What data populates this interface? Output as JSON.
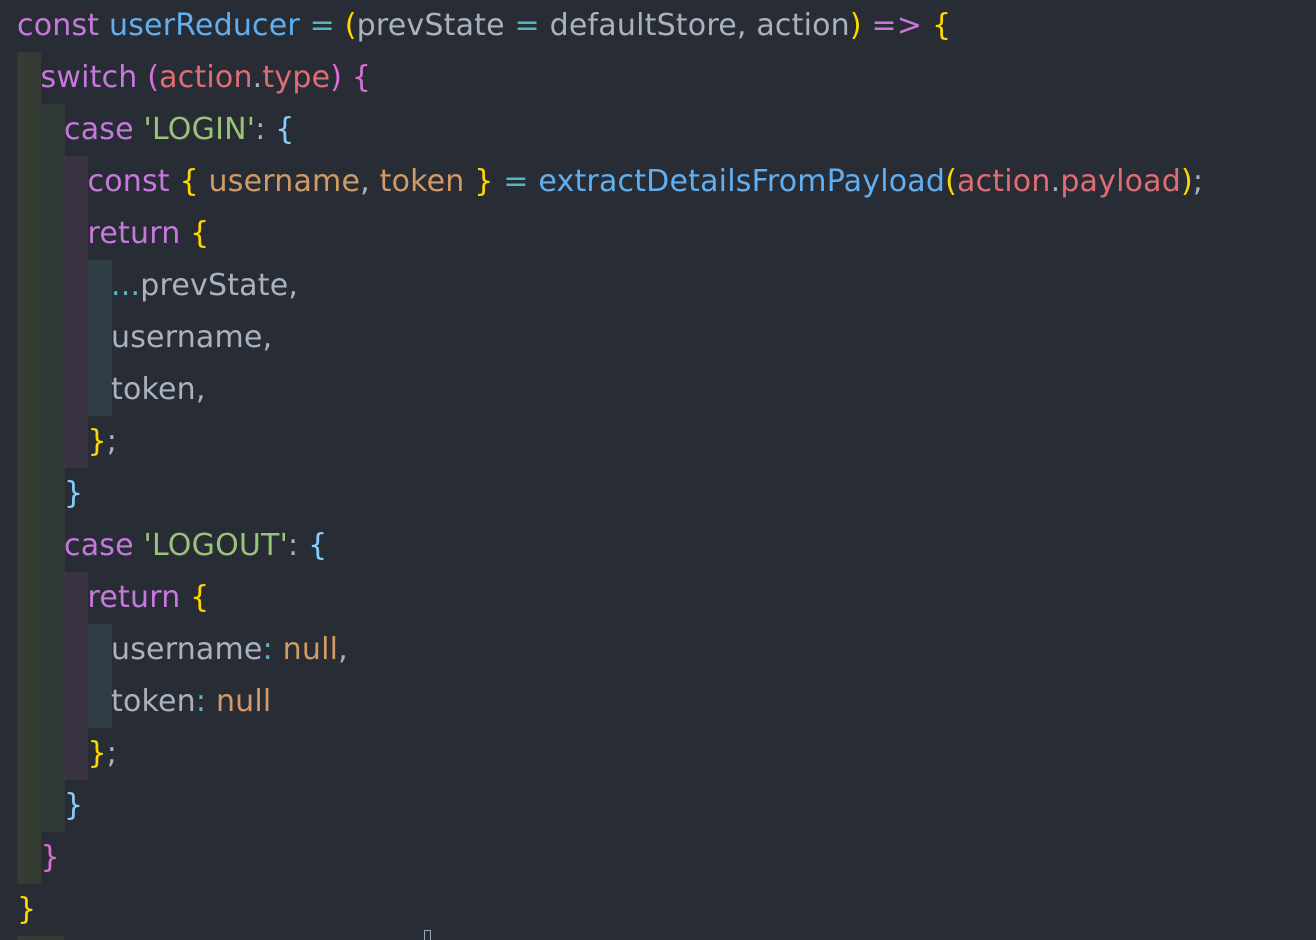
{
  "colors": {
    "background": "#282c34",
    "guide_level_1": "#343c33",
    "guide_level_2": "#2f3a38",
    "guide_level_3": "#3a3342",
    "guide_level_4": "#2f3e45",
    "keyword": "#c678dd",
    "identifier": "#abb2bf",
    "function_name": "#61afef",
    "operator": "#56b6c2",
    "bracket_1": "#ffd700",
    "bracket_2": "#da70d6",
    "bracket_3": "#87cefa",
    "string": "#98c379",
    "property": "#e06c75",
    "variable": "#d19a66",
    "constant": "#d19a66"
  },
  "code": {
    "lines": [
      {
        "indent": 0,
        "tokens": [
          {
            "text": "const ",
            "kind": "keyword"
          },
          {
            "text": "userReducer",
            "kind": "decl"
          },
          {
            "text": " = ",
            "kind": "operator"
          },
          {
            "text": "(",
            "kind": "bracket_1"
          },
          {
            "text": "prevState",
            "kind": "identifier"
          },
          {
            "text": " = ",
            "kind": "operator"
          },
          {
            "text": "defaultStore, action",
            "kind": "identifier"
          },
          {
            "text": ")",
            "kind": "bracket_1"
          },
          {
            "text": " => ",
            "kind": "keyword"
          },
          {
            "text": "{",
            "kind": "bracket_1"
          }
        ]
      },
      {
        "indent": 1,
        "tokens": [
          {
            "text": "switch ",
            "kind": "keyword"
          },
          {
            "text": "(",
            "kind": "bracket_2"
          },
          {
            "text": "action",
            "kind": "property"
          },
          {
            "text": ".",
            "kind": "identifier"
          },
          {
            "text": "type",
            "kind": "property"
          },
          {
            "text": ")",
            "kind": "bracket_2"
          },
          {
            "text": " ",
            "kind": "identifier"
          },
          {
            "text": "{",
            "kind": "bracket_2"
          }
        ]
      },
      {
        "indent": 2,
        "tokens": [
          {
            "text": "case ",
            "kind": "keyword"
          },
          {
            "text": "'LOGIN'",
            "kind": "string"
          },
          {
            "text": ": ",
            "kind": "identifier"
          },
          {
            "text": "{",
            "kind": "bracket_3"
          }
        ]
      },
      {
        "indent": 3,
        "tokens": [
          {
            "text": "const ",
            "kind": "keyword"
          },
          {
            "text": "{ ",
            "kind": "bracket_1"
          },
          {
            "text": "username",
            "kind": "variable"
          },
          {
            "text": ", ",
            "kind": "identifier"
          },
          {
            "text": "token",
            "kind": "variable"
          },
          {
            "text": " }",
            "kind": "bracket_1"
          },
          {
            "text": " = ",
            "kind": "operator"
          },
          {
            "text": "extractDetailsFromPayload",
            "kind": "function_name"
          },
          {
            "text": "(",
            "kind": "bracket_1"
          },
          {
            "text": "action",
            "kind": "property"
          },
          {
            "text": ".",
            "kind": "identifier"
          },
          {
            "text": "payload",
            "kind": "property"
          },
          {
            "text": ")",
            "kind": "bracket_1"
          },
          {
            "text": ";",
            "kind": "identifier"
          }
        ]
      },
      {
        "indent": 3,
        "tokens": [
          {
            "text": "return ",
            "kind": "keyword"
          },
          {
            "text": "{",
            "kind": "bracket_1"
          }
        ]
      },
      {
        "indent": 4,
        "tokens": [
          {
            "text": "...",
            "kind": "operator"
          },
          {
            "text": "prevState,",
            "kind": "identifier"
          }
        ]
      },
      {
        "indent": 4,
        "tokens": [
          {
            "text": "username,",
            "kind": "identifier"
          }
        ]
      },
      {
        "indent": 4,
        "tokens": [
          {
            "text": "token,",
            "kind": "identifier"
          }
        ]
      },
      {
        "indent": 3,
        "tokens": [
          {
            "text": "}",
            "kind": "bracket_1"
          },
          {
            "text": ";",
            "kind": "identifier"
          }
        ]
      },
      {
        "indent": 2,
        "tokens": [
          {
            "text": "}",
            "kind": "bracket_3"
          }
        ]
      },
      {
        "indent": 2,
        "tokens": [
          {
            "text": "case ",
            "kind": "keyword"
          },
          {
            "text": "'LOGOUT'",
            "kind": "string"
          },
          {
            "text": ": ",
            "kind": "identifier"
          },
          {
            "text": "{",
            "kind": "bracket_3"
          }
        ]
      },
      {
        "indent": 3,
        "tokens": [
          {
            "text": "return ",
            "kind": "keyword"
          },
          {
            "text": "{",
            "kind": "bracket_1"
          }
        ]
      },
      {
        "indent": 4,
        "tokens": [
          {
            "text": "username",
            "kind": "identifier"
          },
          {
            "text": ": ",
            "kind": "operator"
          },
          {
            "text": "null",
            "kind": "constant"
          },
          {
            "text": ",",
            "kind": "identifier"
          }
        ]
      },
      {
        "indent": 4,
        "tokens": [
          {
            "text": "token",
            "kind": "identifier"
          },
          {
            "text": ": ",
            "kind": "operator"
          },
          {
            "text": "null",
            "kind": "constant"
          }
        ]
      },
      {
        "indent": 3,
        "tokens": [
          {
            "text": "}",
            "kind": "bracket_1"
          },
          {
            "text": ";",
            "kind": "identifier"
          }
        ]
      },
      {
        "indent": 2,
        "tokens": [
          {
            "text": "}",
            "kind": "bracket_3"
          }
        ]
      },
      {
        "indent": 1,
        "tokens": [
          {
            "text": "}",
            "kind": "bracket_2"
          }
        ]
      },
      {
        "indent": 0,
        "tokens": [
          {
            "text": "}",
            "kind": "bracket_1"
          }
        ]
      }
    ]
  }
}
